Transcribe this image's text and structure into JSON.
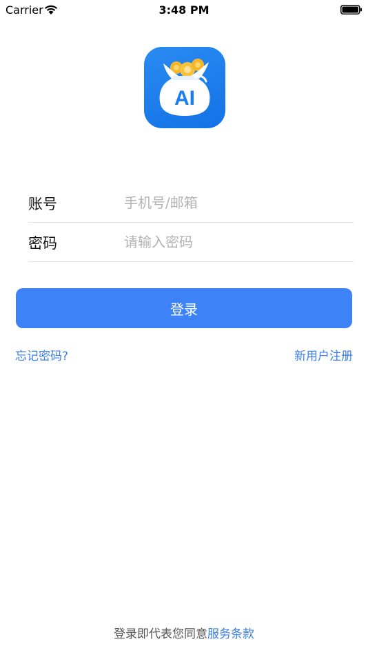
{
  "status_bar": {
    "carrier": "Carrier",
    "time": "3:48 PM"
  },
  "logo": {
    "text": "AI",
    "icon": "money-bag-icon",
    "colors": {
      "background": "#1a7ef0",
      "bag": "#ffffff",
      "coin": "#f5b62a"
    }
  },
  "form": {
    "account": {
      "label": "账号",
      "placeholder": "手机号/邮箱",
      "value": ""
    },
    "password": {
      "label": "密码",
      "placeholder": "请输入密码",
      "value": ""
    }
  },
  "login_button": {
    "label": "登录",
    "color": "#3d82f7"
  },
  "links": {
    "forgot_password": "忘记密码?",
    "register": "新用户注册"
  },
  "footer": {
    "prefix": "登录即代表您同意",
    "terms": "服务条款"
  }
}
